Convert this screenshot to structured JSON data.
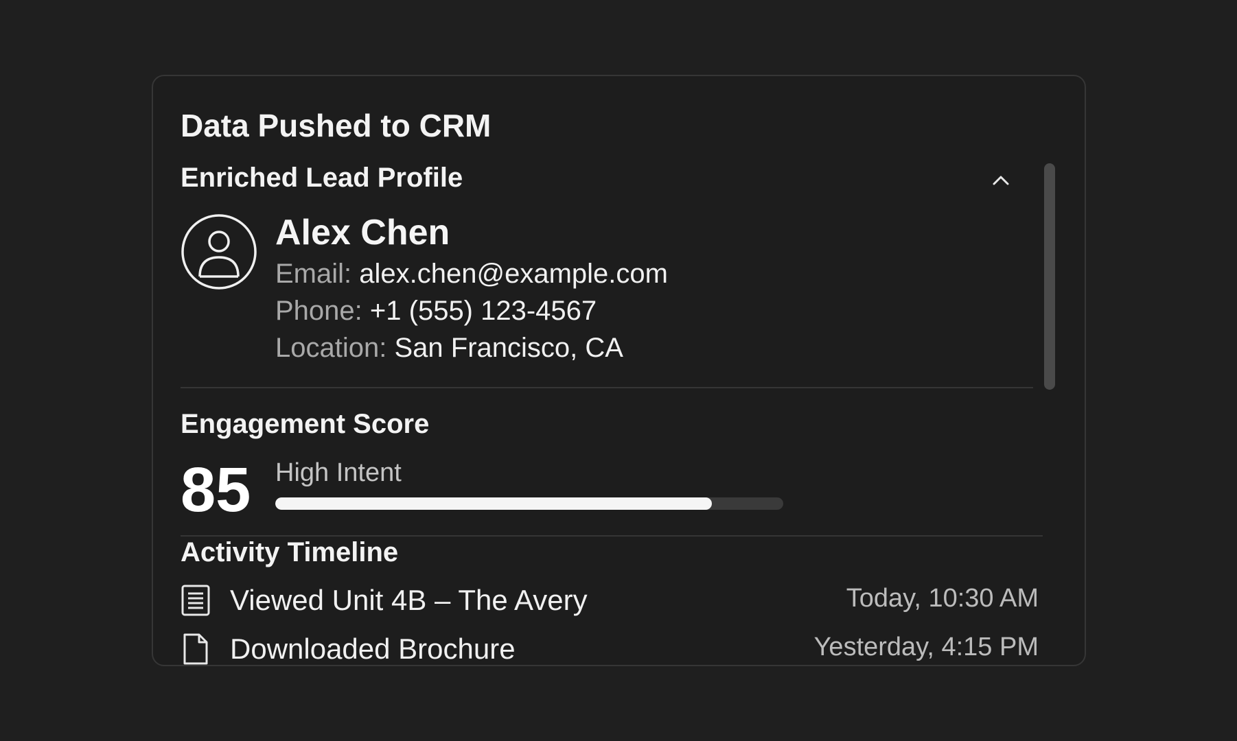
{
  "card": {
    "title": "Data Pushed to CRM"
  },
  "profile": {
    "section_title": "Enriched Lead Profile",
    "collapse_icon": "chevron-up-icon",
    "avatar_icon": "user-avatar-icon",
    "name": "Alex Chen",
    "email_label": "Email:",
    "email_value": "alex.chen@example.com",
    "phone_label": "Phone:",
    "phone_value": "+1 (555) 123-4567",
    "location_label": "Location:",
    "location_value": "San Francisco, CA"
  },
  "engagement": {
    "section_title": "Engagement Score",
    "score": "85",
    "intent_label": "High Intent",
    "progress_fraction": 0.86
  },
  "timeline": {
    "section_title": "Activity Timeline",
    "items": [
      {
        "icon": "document-list-icon",
        "label": "Viewed Unit 4B – The Avery",
        "time": "Today, 10:30 AM"
      },
      {
        "icon": "file-icon",
        "label": "Downloaded Brochure",
        "time": "Yesterday, 4:15 PM"
      }
    ]
  },
  "colors": {
    "background": "#1f1f1f",
    "card_border": "#363636",
    "progress_fill": "#f5f5f5",
    "progress_track": "#3a3a3a"
  }
}
